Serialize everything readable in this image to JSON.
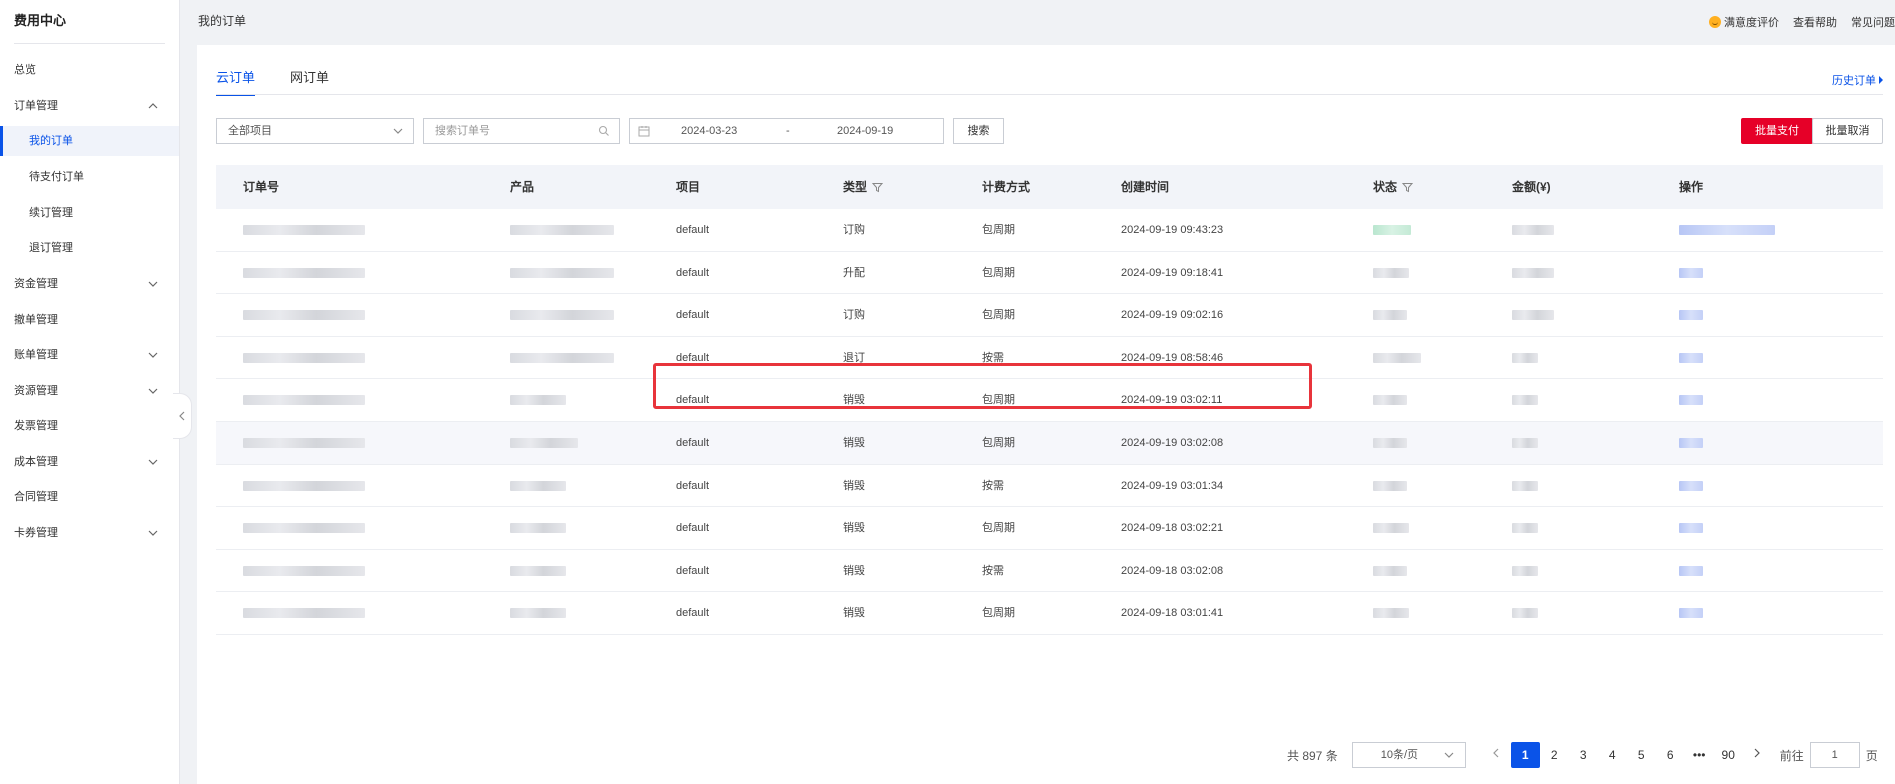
{
  "sidebar": {
    "title": "费用中心",
    "items": [
      {
        "label": "总览"
      },
      {
        "label": "订单管理"
      },
      {
        "label": "我的订单"
      },
      {
        "label": "待支付订单"
      },
      {
        "label": "续订管理"
      },
      {
        "label": "退订管理"
      },
      {
        "label": "资金管理"
      },
      {
        "label": "撤单管理"
      },
      {
        "label": "账单管理"
      },
      {
        "label": "资源管理"
      },
      {
        "label": "发票管理"
      },
      {
        "label": "成本管理"
      },
      {
        "label": "合同管理"
      },
      {
        "label": "卡券管理"
      }
    ]
  },
  "header": {
    "breadcrumb": "我的订单",
    "links": {
      "satisfaction": "满意度评价",
      "help": "查看帮助",
      "faq": "常见问题"
    }
  },
  "tabs": [
    {
      "label": "云订单"
    },
    {
      "label": "网订单"
    }
  ],
  "history_link": "历史订单",
  "filters": {
    "project_select": "全部项目",
    "search_placeholder": "搜索订单号",
    "date_start": "2024-03-23",
    "date_sep": "-",
    "date_end": "2024-09-19",
    "search_button": "搜索"
  },
  "actions": {
    "batch_pay": "批量支付",
    "batch_cancel": "批量取消"
  },
  "table": {
    "columns": [
      "订单号",
      "产品",
      "项目",
      "类型",
      "计费方式",
      "创建时间",
      "状态",
      "金额(¥)",
      "操作"
    ],
    "rows": [
      {
        "project": "default",
        "type": "订购",
        "billing": "包周期",
        "created": "2024-09-19 09:43:23"
      },
      {
        "project": "default",
        "type": "升配",
        "billing": "包周期",
        "created": "2024-09-19 09:18:41"
      },
      {
        "project": "default",
        "type": "订购",
        "billing": "包周期",
        "created": "2024-09-19 09:02:16"
      },
      {
        "project": "default",
        "type": "退订",
        "billing": "按需",
        "created": "2024-09-19 08:58:46"
      },
      {
        "project": "default",
        "type": "销毁",
        "billing": "包周期",
        "created": "2024-09-19 03:02:11"
      },
      {
        "project": "default",
        "type": "销毁",
        "billing": "包周期",
        "created": "2024-09-19 03:02:08"
      },
      {
        "project": "default",
        "type": "销毁",
        "billing": "按需",
        "created": "2024-09-19 03:01:34"
      },
      {
        "project": "default",
        "type": "销毁",
        "billing": "包周期",
        "created": "2024-09-18 03:02:21"
      },
      {
        "project": "default",
        "type": "销毁",
        "billing": "按需",
        "created": "2024-09-18 03:02:08"
      },
      {
        "project": "default",
        "type": "销毁",
        "billing": "包周期",
        "created": "2024-09-18 03:01:41"
      }
    ]
  },
  "pagination": {
    "total": "共 897 条",
    "page_size": "10条/页",
    "pages": [
      "1",
      "2",
      "3",
      "4",
      "5",
      "6",
      "•••",
      "90"
    ],
    "goto_label": "前往",
    "goto_value": "1",
    "page_unit": "页"
  },
  "colors": {
    "accent": "#0a53e8",
    "danger": "#e60028",
    "highlight_box": "#e8343b"
  }
}
